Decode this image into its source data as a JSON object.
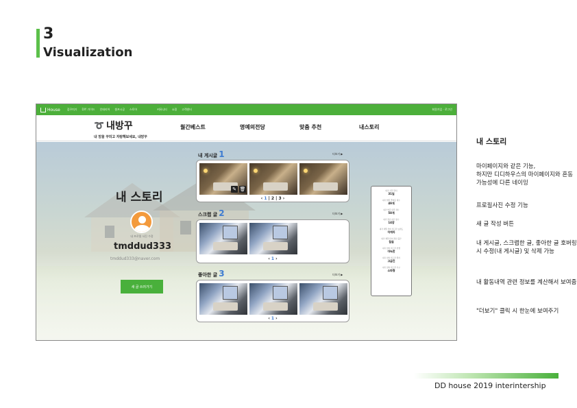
{
  "slide": {
    "number": "3",
    "title": "Visualization"
  },
  "topbar": {
    "logo": "House",
    "links": [
      "집꾸미기",
      "DIY 가이드",
      "인테리어",
      "셀프시공",
      "스토어",
      "커뮤니티",
      "쇼핑",
      "고객센터"
    ],
    "right": "회원가입 · 로그인"
  },
  "navbar": {
    "brand": "내방꾸",
    "brand_sub": "내 방을 꾸미고 자랑해보세요, 내방꾸",
    "links": [
      "월간베스트",
      "명예의전당",
      "맞춤 추천",
      "내스토리"
    ]
  },
  "profile": {
    "page_title": "내 스토리",
    "avatar_caption": "내 프로필 사진 수정",
    "username": "tmddud333",
    "email": "tmddud333@naver.com",
    "write_button": "새 글 쓰러가기"
  },
  "sections": [
    {
      "label": "내 게시글",
      "count": "1",
      "more": "더보기 ▶",
      "pager": [
        "1",
        "2",
        "3"
      ]
    },
    {
      "label": "스크랩 글",
      "count": "2",
      "more": "더보기 ▶",
      "pager": [
        "1"
      ]
    },
    {
      "label": "좋아한 글",
      "count": "3",
      "more": "더보기 ▶",
      "pager": [
        "1"
      ]
    }
  ],
  "stats": [
    {
      "label": "내가 가입 한지",
      "value": "31일"
    },
    {
      "label": "내가 받은 좋아요 개수",
      "value": "49개"
    },
    {
      "label": "내가 받은 댓글 개수",
      "value": "58개"
    },
    {
      "label": "내가 올린 사진 장수",
      "value": "14장"
    },
    {
      "label": "내가 제일 많이 태그한 브랜드",
      "value": "이케아"
    },
    {
      "label": "내가 제일 많이 올린 공간",
      "value": "침실"
    },
    {
      "label": "내가 많이 태그한 컨셉",
      "value": "아늑한"
    },
    {
      "label": "내가 많이 태그한 컬러",
      "value": "고급진"
    },
    {
      "label": "내가 많이 태그한 가구",
      "value": "소파형"
    }
  ],
  "description": {
    "title": "내 스토리",
    "paragraphs": [
      "마이페이지와 같은 기능,\n하지만 디디하우스의 마이페이지와 혼동 가능성에 다른 네이밍",
      "프로필사진 수정 기능",
      "새 글 작성 버튼",
      "내 게시글, 스크랩한 글, 좋아한 글 호버링시 수정(내 게시글) 및 삭제 가능",
      "내 활동내역 관련 정보를 계산해서 보여줌",
      "\"더보기\" 클릭 시 한눈에 보여주기"
    ]
  },
  "footer": {
    "text": "DD house 2019 interintership"
  },
  "colors": {
    "accent": "#49b03b",
    "topbar": "#4caf3a",
    "highlight": "#3d7bd1"
  }
}
